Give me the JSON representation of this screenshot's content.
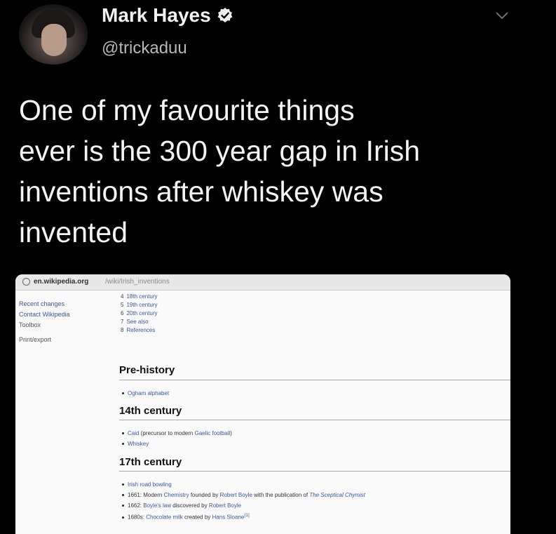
{
  "tweet": {
    "author": {
      "display_name": "Mark Hayes",
      "handle": "@trickaduu",
      "verified": true,
      "avatar_icon": "profile-photo"
    },
    "menu_icon": "chevron-down-icon",
    "text_lines": [
      "One of my favourite things",
      "ever is the 300 year gap in Irish",
      "inventions after whiskey was",
      "invented"
    ]
  },
  "screenshot": {
    "url": {
      "domain": "en.wikipedia.org",
      "path": "/wiki/Irish_inventions"
    },
    "sidebar": [
      "Recent changes",
      "Contact Wikipedia",
      "Toolbox",
      "Print/export"
    ],
    "toc": [
      {
        "num": "4",
        "label": "18th century"
      },
      {
        "num": "5",
        "label": "19th century"
      },
      {
        "num": "6",
        "label": "20th century"
      },
      {
        "num": "7",
        "label": "See also"
      },
      {
        "num": "8",
        "label": "References"
      }
    ],
    "sections": {
      "prehistory": {
        "title": "Pre-history",
        "items": [
          "Ogham alphabet"
        ]
      },
      "c14": {
        "title": "14th century",
        "items": [
          {
            "link": "Caid",
            "text": " (precursor to modern ",
            "link2": "Gaelic football",
            "tail": ")"
          },
          {
            "link": "Whiskey"
          }
        ]
      },
      "c17": {
        "title": "17th century",
        "items": [
          {
            "link": "Irish road bowling"
          },
          {
            "pre": "1661: Modern ",
            "link": "Chemistry",
            "mid": " founded by ",
            "link2": "Robert Boyle",
            "tail": " with the publication of ",
            "link3": "The Sceptical Chymist"
          },
          {
            "pre": "1662: ",
            "link": "Boyle's law",
            "mid": " discovered by ",
            "link2": "Robert Boyle"
          },
          {
            "pre": "1680s: ",
            "link": "Chocolate milk",
            "mid": " created by ",
            "link2": "Hans Sloane",
            "tail": "[1]"
          }
        ]
      }
    }
  },
  "colors": {
    "background": "#000000",
    "text": "#f4f4f4",
    "handle": "#b8b8b8",
    "wiki_link": "#3a55a0"
  }
}
